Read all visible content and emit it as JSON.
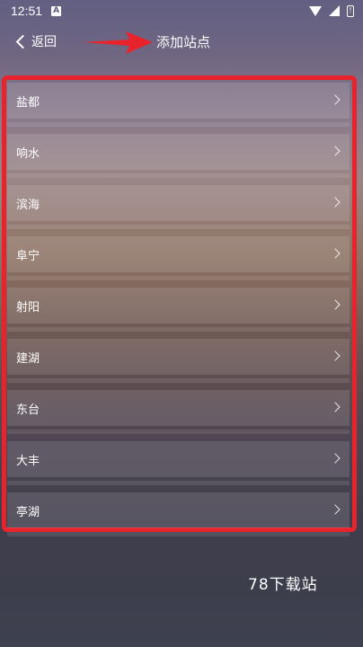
{
  "status_bar": {
    "time": "12:51",
    "notification_badge": "A",
    "battery_glyph": "!"
  },
  "nav": {
    "back_label": "返回",
    "title": "添加站点"
  },
  "stations": [
    {
      "name": "盐都"
    },
    {
      "name": "响水"
    },
    {
      "name": "滨海"
    },
    {
      "name": "阜宁"
    },
    {
      "name": "射阳"
    },
    {
      "name": "建湖"
    },
    {
      "name": "东台"
    },
    {
      "name": "大丰"
    },
    {
      "name": "亭湖"
    }
  ],
  "watermark": "78下载站",
  "colors": {
    "highlight_frame": "#e8232b",
    "text": "#ffffff"
  }
}
